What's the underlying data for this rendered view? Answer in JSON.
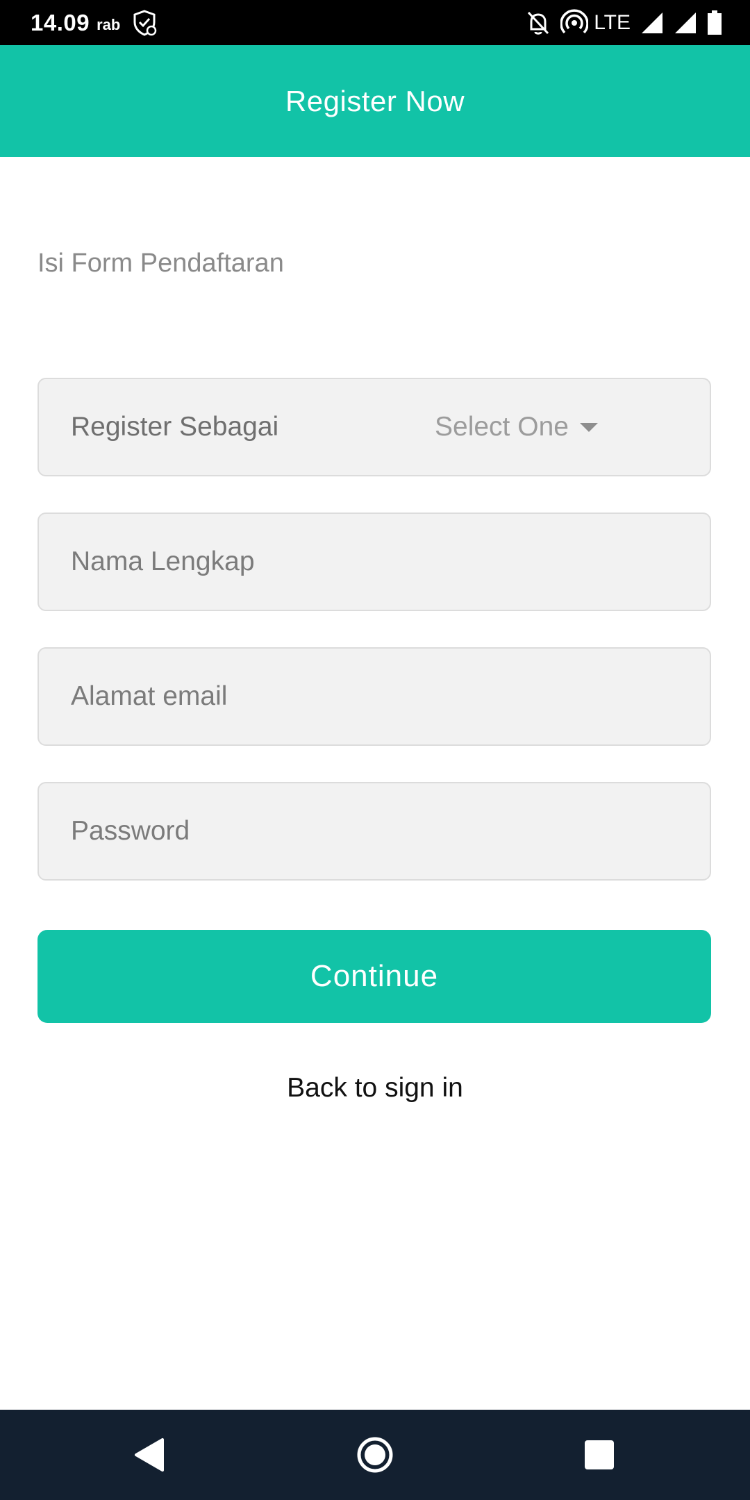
{
  "status_bar": {
    "time": "14.09",
    "day": "rab",
    "network": "LTE",
    "icons": [
      "shield-check-icon",
      "bell-off-icon",
      "hotspot-icon",
      "signal-icon",
      "signal-icon",
      "battery-icon"
    ]
  },
  "app_bar": {
    "title": "Register Now"
  },
  "form": {
    "subtitle": "Isi Form Pendaftaran",
    "register_as": {
      "label": "Register Sebagai",
      "selected": "Select One"
    },
    "full_name": {
      "placeholder": "Nama Lengkap",
      "value": ""
    },
    "email": {
      "placeholder": "Alamat email",
      "value": ""
    },
    "password": {
      "placeholder": "Password",
      "value": ""
    },
    "continue_label": "Continue",
    "back_label": "Back to sign in"
  },
  "nav_bar": {
    "buttons": [
      "back-icon",
      "home-icon",
      "recents-icon"
    ]
  },
  "colors": {
    "accent": "#12c3a7",
    "status_bar": "#000000",
    "nav_bar": "#132030",
    "field_bg": "#f2f2f2"
  }
}
